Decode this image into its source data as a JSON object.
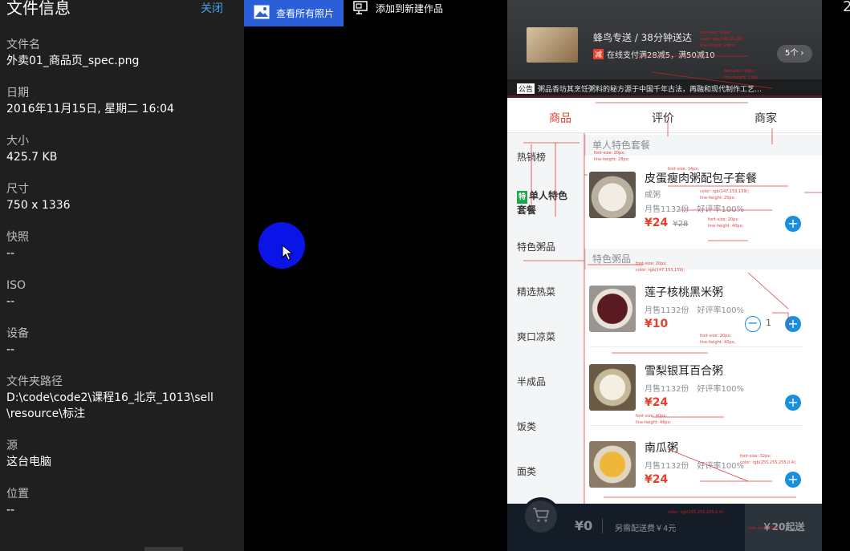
{
  "info_panel": {
    "title": "文件信息",
    "close_label": "关闭",
    "fields": [
      {
        "label": "文件名",
        "value": "外卖01_商品页_spec.png"
      },
      {
        "label": "日期",
        "value": "2016年11月15日, 星期二 16:04"
      },
      {
        "label": "大小",
        "value": "425.7 KB"
      },
      {
        "label": "尺寸",
        "value": "750 x 1336"
      },
      {
        "label": "快照",
        "value": "--"
      },
      {
        "label": "ISO",
        "value": "--"
      },
      {
        "label": "设备",
        "value": "--"
      },
      {
        "label": "文件夹路径",
        "value": "D:\\code\\code2\\课程16_北京_1013\\sell",
        "value2": "\\resource\\标注"
      },
      {
        "label": "源",
        "value": "这台电脑"
      },
      {
        "label": "位置",
        "value": "--"
      }
    ]
  },
  "toolbar": {
    "all_photos_label": "查看所有照片",
    "add_work_label": "添加到新建作品",
    "zoom_icon": "zoom-in-icon",
    "delete_icon": "trash-icon",
    "rotate_icon": "rotate-icon"
  },
  "preview": {
    "header": {
      "brand": "蜂鸟专送 / 38分钟送达",
      "offer_badge": "减",
      "offer": "在线支付满28减5，满50减10",
      "count": "5个 ›",
      "notice_tag": "公告",
      "notice": "粥品香坊其烹饪粥料的秘方源于中国千年古法，再融和现代制作工艺…"
    },
    "tabs": [
      "商品",
      "评价",
      "商家"
    ],
    "menu": [
      {
        "label": "热销榜"
      },
      {
        "badge": "特",
        "label": "单人特色套餐"
      },
      {
        "label": "特色粥品"
      },
      {
        "label": "精选热菜"
      },
      {
        "label": "爽口凉菜"
      },
      {
        "label": "半成品"
      },
      {
        "label": "饭类"
      },
      {
        "label": "面类"
      }
    ],
    "groups": {
      "single": "单人特色套餐",
      "special": "特色粥品"
    },
    "foods": [
      {
        "name": "皮蛋瘦肉粥配包子套餐",
        "desc": "咸粥",
        "sales": "月售1132份",
        "rating": "好评率100%",
        "price": "¥24",
        "old_price": "¥28"
      },
      {
        "name": "莲子核桃黑米粥",
        "desc": "",
        "sales": "月售1132份",
        "rating": "好评率100%",
        "price": "¥10",
        "old_price": "",
        "count": "1"
      },
      {
        "name": "雪梨银耳百合粥",
        "desc": "",
        "sales": "月售1132份",
        "rating": "好评率100%",
        "price": "¥24",
        "old_price": ""
      },
      {
        "name": "南瓜粥",
        "desc": "",
        "sales": "月售1132份",
        "rating": "好评率100%",
        "price": "¥24",
        "old_price": ""
      }
    ],
    "cart": {
      "price": "¥0",
      "delivery": "另需配送费￥4元",
      "min_order": "￥20起送"
    }
  },
  "colors": {
    "accent_blue": "#2b5fd9",
    "brand_red": "#e6402e",
    "add_blue": "#1a8fe0"
  }
}
